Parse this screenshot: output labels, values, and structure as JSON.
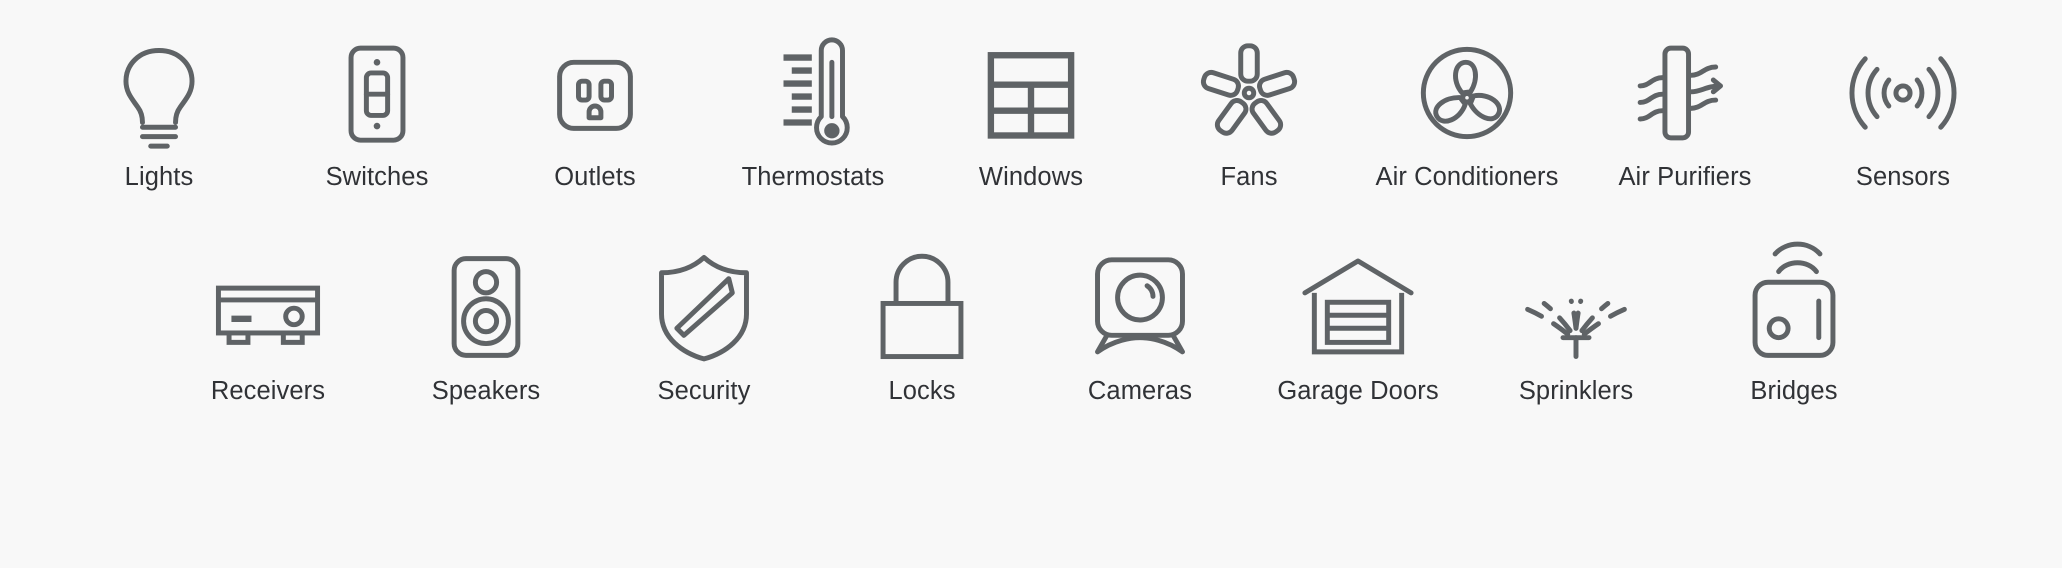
{
  "page": {
    "background_color": "#f8f8f8",
    "icon_stroke_color": "#5f6366",
    "label_color": "#303236"
  },
  "rows": [
    {
      "id": "row-devices-primary",
      "items": [
        {
          "label": "Lights",
          "icon": "light-bulb-icon"
        },
        {
          "label": "Switches",
          "icon": "light-switch-icon"
        },
        {
          "label": "Outlets",
          "icon": "power-outlet-icon"
        },
        {
          "label": "Thermostats",
          "icon": "thermometer-icon"
        },
        {
          "label": "Windows",
          "icon": "window-icon"
        },
        {
          "label": "Fans",
          "icon": "ceiling-fan-icon"
        },
        {
          "label": "Air Conditioners",
          "icon": "air-conditioner-icon"
        },
        {
          "label": "Air Purifiers",
          "icon": "air-purifier-icon"
        },
        {
          "label": "Sensors",
          "icon": "sensor-waves-icon"
        }
      ]
    },
    {
      "id": "row-devices-secondary",
      "items": [
        {
          "label": "Receivers",
          "icon": "av-receiver-icon"
        },
        {
          "label": "Speakers",
          "icon": "speaker-icon"
        },
        {
          "label": "Security",
          "icon": "shield-icon"
        },
        {
          "label": "Locks",
          "icon": "padlock-icon"
        },
        {
          "label": "Cameras",
          "icon": "camera-icon"
        },
        {
          "label": "Garage Doors",
          "icon": "garage-door-icon"
        },
        {
          "label": "Sprinklers",
          "icon": "sprinkler-icon"
        },
        {
          "label": "Bridges",
          "icon": "bridge-hub-icon"
        }
      ]
    }
  ]
}
